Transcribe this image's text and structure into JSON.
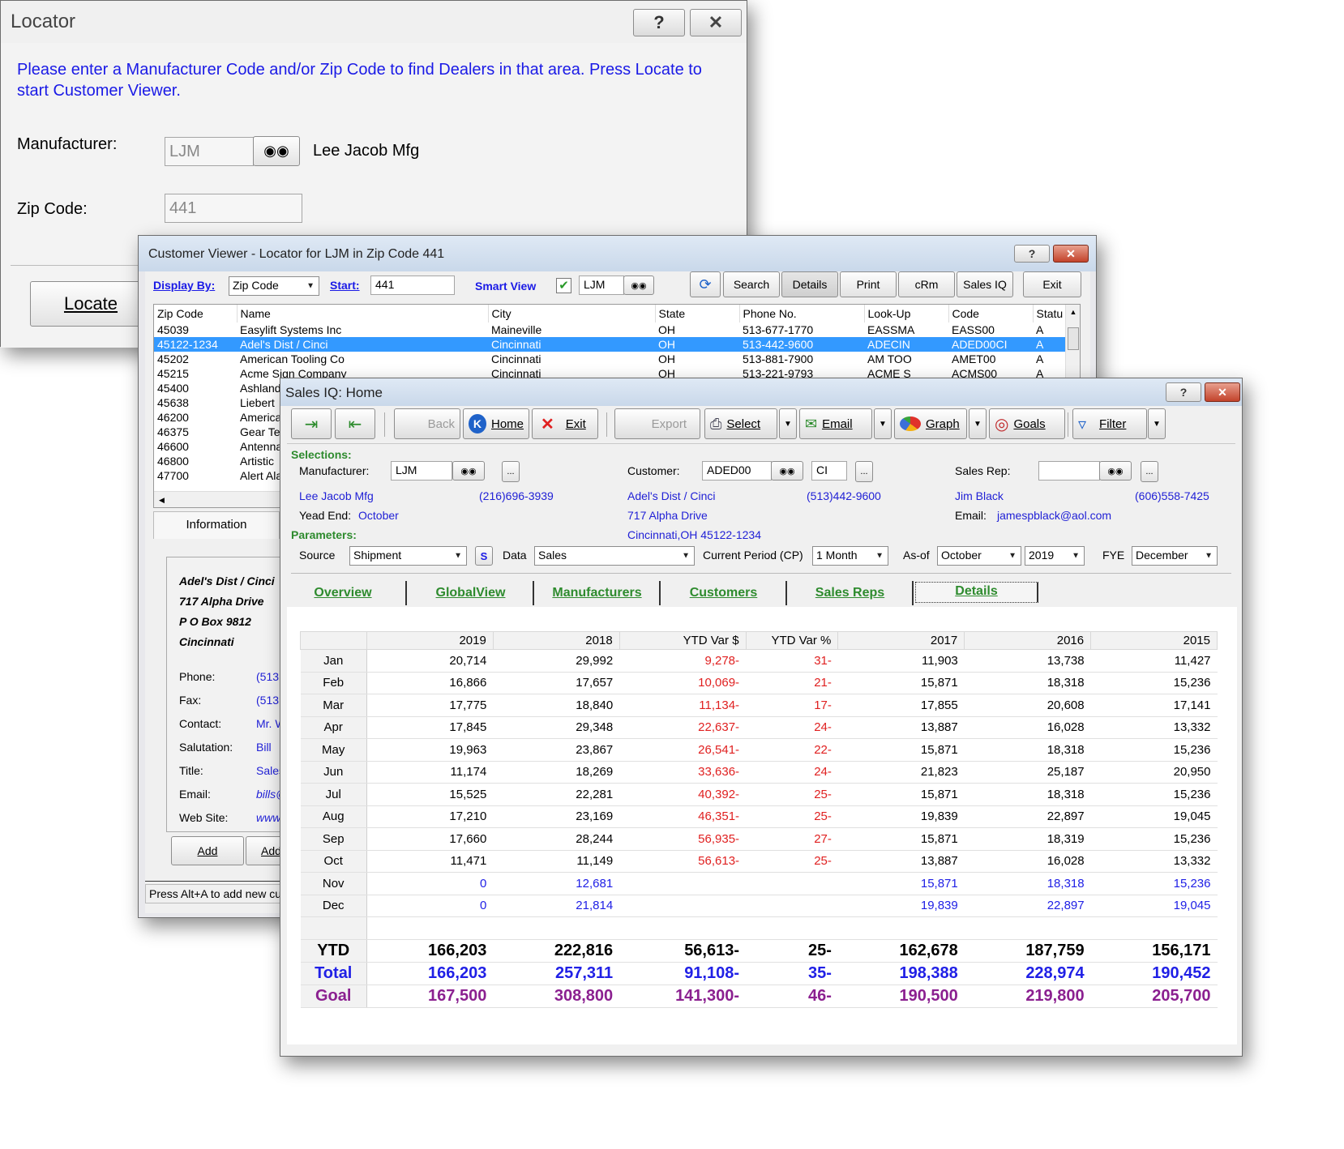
{
  "locator": {
    "title": "Locator",
    "help_label": "?",
    "close_label": "✕",
    "instruction": "Please enter a Manufacturer Code and/or Zip Code to find Dealers in that area. Press Locate to start Customer Viewer.",
    "manufacturer_label": "Manufacturer:",
    "manufacturer_value": "LJM",
    "manufacturer_name": "Lee Jacob Mfg",
    "zip_label": "Zip Code:",
    "zip_value": "441",
    "locate_label": "Locate"
  },
  "viewer": {
    "title": "Customer Viewer - Locator for LJM in Zip Code 441",
    "display_by_label": "Display By:",
    "display_by_value": "Zip Code",
    "start_label": "Start:",
    "start_value": "441",
    "smart_view_label": "Smart View",
    "smart_view_value": "LJM",
    "buttons": {
      "search": "Search",
      "details": "Details",
      "print": "Print",
      "crm": "cRm",
      "salesiq": "Sales IQ",
      "exit": "Exit"
    },
    "columns": [
      "Zip Code",
      "Name",
      "City",
      "State",
      "Phone No.",
      "Look-Up",
      "Code",
      "Statu"
    ],
    "rows": [
      [
        "45039",
        "Easylift Systems Inc",
        "Maineville",
        "OH",
        "513-677-1770",
        "EASSMA",
        "EASS00",
        "A"
      ],
      [
        "45122-1234",
        "Adel's Dist / Cinci",
        "Cincinnati",
        "OH",
        "513-442-9600",
        "ADECIN",
        "ADED00CI",
        "A"
      ],
      [
        "45202",
        "American Tooling Co",
        "Cincinnati",
        "OH",
        "513-881-7900",
        "AM TOO",
        "AMET00",
        "A"
      ],
      [
        "45215",
        "Acme Sign Company",
        "Cincinnati",
        "OH",
        "513-221-9793",
        "ACME S",
        "ACMS00",
        "A"
      ],
      [
        "45400",
        "Ashland",
        "",
        "",
        "",
        "",
        "",
        ""
      ],
      [
        "45638",
        "Liebert",
        "",
        "",
        "",
        "",
        "",
        ""
      ],
      [
        "46200",
        "America",
        "",
        "",
        "",
        "",
        "",
        ""
      ],
      [
        "46375",
        "Gear Te",
        "",
        "",
        "",
        "",
        "",
        ""
      ],
      [
        "46600",
        "Antenna",
        "",
        "",
        "",
        "",
        "",
        ""
      ],
      [
        "46800",
        "Artistic",
        "",
        "",
        "",
        "",
        "",
        ""
      ],
      [
        "47700",
        "Alert Ala",
        "",
        "",
        "",
        "",
        "",
        ""
      ]
    ],
    "info_tab": "Information",
    "address": [
      "Adel's Dist / Cinci",
      "717 Alpha Drive",
      "P O Box 9812",
      "Cincinnati"
    ],
    "phone_label": "Phone:",
    "phone_value": "(513",
    "fax_label": "Fax:",
    "fax_value": "(513",
    "contact_label": "Contact:",
    "contact_value": "Mr. W",
    "salutation_label": "Salutation:",
    "salutation_value": "Bill",
    "title_label": "Title:",
    "title_value": "Sales",
    "email_label": "Email:",
    "email_value": "bills@",
    "website_label": "Web Site:",
    "website_value": "www.",
    "add_label": "Add",
    "add2_label": "Add",
    "status_text": "Press Alt+A to add new cu"
  },
  "salesiq": {
    "title": "Sales IQ: Home",
    "toolbar": {
      "back": "Back",
      "home": "Home",
      "exit": "Exit",
      "export": "Export",
      "select": "Select",
      "email": "Email",
      "graph": "Graph",
      "goals": "Goals",
      "filter": "Filter"
    },
    "selections_label": "Selections:",
    "manufacturer_label": "Manufacturer:",
    "manufacturer_value": "LJM",
    "manufacturer_name": "Lee Jacob Mfg",
    "manufacturer_phone": "(216)696-3939",
    "year_end_label": "Yead End:",
    "year_end_value": "October",
    "customer_label": "Customer:",
    "customer_value": "ADED00",
    "customer_suffix": "CI",
    "customer_name": "Adel's Dist / Cinci",
    "customer_phone": "(513)442-9600",
    "customer_street": "717 Alpha Drive",
    "customer_city": "Cincinnati,OH 45122-1234",
    "rep_label": "Sales Rep:",
    "rep_name": "Jim Black",
    "rep_phone": "(606)558-7425",
    "rep_email_label": "Email:",
    "rep_email": "jamespblack@aol.com",
    "parameters_label": "Parameters:",
    "source_label": "Source",
    "source_value": "Shipment",
    "s_label": "S",
    "data_label": "Data",
    "data_value": "Sales",
    "period_label": "Current Period (CP)",
    "period_value": "1 Month",
    "asof_label": "As-of",
    "asof_month": "October",
    "asof_year": "2019",
    "fye_label": "FYE",
    "fye_value": "December",
    "tabs": [
      "Overview",
      "GlobalView",
      "Manufacturers",
      "Customers",
      "Sales Reps",
      "Details"
    ],
    "columns": [
      "",
      "2019",
      "2018",
      "YTD Var $",
      "YTD Var %",
      "2017",
      "2016",
      "2015"
    ],
    "rows": [
      [
        "Jan",
        "20,714",
        "29,992",
        "9,278-",
        "31-",
        "11,903",
        "13,738",
        "11,427"
      ],
      [
        "Feb",
        "16,866",
        "17,657",
        "10,069-",
        "21-",
        "15,871",
        "18,318",
        "15,236"
      ],
      [
        "Mar",
        "17,775",
        "18,840",
        "11,134-",
        "17-",
        "17,855",
        "20,608",
        "17,141"
      ],
      [
        "Apr",
        "17,845",
        "29,348",
        "22,637-",
        "24-",
        "13,887",
        "16,028",
        "13,332"
      ],
      [
        "May",
        "19,963",
        "23,867",
        "26,541-",
        "22-",
        "15,871",
        "18,318",
        "15,236"
      ],
      [
        "Jun",
        "11,174",
        "18,269",
        "33,636-",
        "24-",
        "21,823",
        "25,187",
        "20,950"
      ],
      [
        "Jul",
        "15,525",
        "22,281",
        "40,392-",
        "25-",
        "15,871",
        "18,318",
        "15,236"
      ],
      [
        "Aug",
        "17,210",
        "23,169",
        "46,351-",
        "25-",
        "19,839",
        "22,897",
        "19,045"
      ],
      [
        "Sep",
        "17,660",
        "28,244",
        "56,935-",
        "27-",
        "15,871",
        "18,319",
        "15,236"
      ],
      [
        "Oct",
        "11,471",
        "11,149",
        "56,613-",
        "25-",
        "13,887",
        "16,028",
        "13,332"
      ]
    ],
    "proj_rows": [
      [
        "Nov",
        "0",
        "12,681",
        "",
        "",
        "15,871",
        "18,318",
        "15,236"
      ],
      [
        "Dec",
        "0",
        "21,814",
        "",
        "",
        "19,839",
        "22,897",
        "19,045"
      ]
    ],
    "ytd": [
      "YTD",
      "166,203",
      "222,816",
      "56,613-",
      "25-",
      "162,678",
      "187,759",
      "156,171"
    ],
    "total": [
      "Total",
      "166,203",
      "257,311",
      "91,108-",
      "35-",
      "198,388",
      "228,974",
      "190,452"
    ],
    "goal": [
      "Goal",
      "167,500",
      "308,800",
      "141,300-",
      "46-",
      "190,500",
      "219,800",
      "205,700"
    ],
    "colors": {
      "negative": "#e02020",
      "projected": "#2020e6",
      "goal": "#8b2090",
      "accent": "#2e8b2e"
    }
  }
}
